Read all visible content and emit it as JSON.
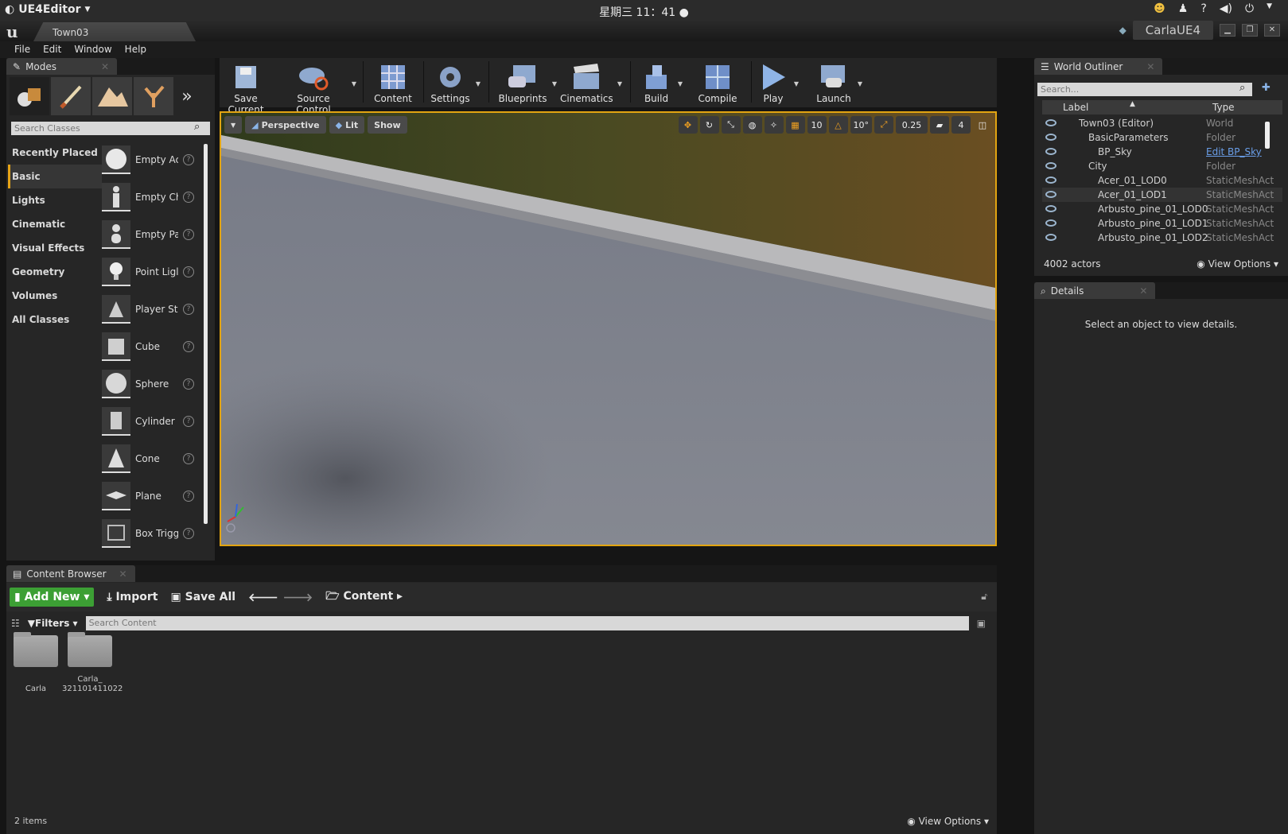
{
  "system": {
    "app_name": "UE4Editor",
    "clock": "星期三 11：41"
  },
  "window": {
    "tab": "Town03",
    "project": "CarlaUE4"
  },
  "menu": [
    "File",
    "Edit",
    "Window",
    "Help"
  ],
  "modes": {
    "title": "Modes",
    "search_placeholder": "Search Classes",
    "categories": [
      "Recently Placed",
      "Basic",
      "Lights",
      "Cinematic",
      "Visual Effects",
      "Geometry",
      "Volumes",
      "All Classes"
    ],
    "items": [
      "Empty Ac",
      "Empty Ch",
      "Empty Pa",
      "Point Ligl",
      "Player St",
      "Cube",
      "Sphere",
      "Cylinder",
      "Cone",
      "Plane",
      "Box Trigg"
    ]
  },
  "toolbar": {
    "buttons": [
      "Save Current",
      "Source Control",
      "Content",
      "Settings",
      "Blueprints",
      "Cinematics",
      "Build",
      "Compile",
      "Play",
      "Launch"
    ]
  },
  "viewport": {
    "view_mode": "Perspective",
    "lighting": "Lit",
    "show": "Show",
    "grid_snap": "10",
    "rotation_snap": "10°",
    "scale_snap": "0.25",
    "camera_speed": "4"
  },
  "outliner": {
    "title": "World Outliner",
    "search_placeholder": "Search...",
    "col_label": "Label",
    "col_type": "Type",
    "rows": [
      {
        "label": "Town03 (Editor)",
        "type": "World"
      },
      {
        "label": "BasicParameters",
        "type": "Folder"
      },
      {
        "label": "BP_Sky",
        "type": "Edit BP_Sky"
      },
      {
        "label": "City",
        "type": "Folder"
      },
      {
        "label": "Acer_01_LOD0",
        "type": "StaticMeshAct"
      },
      {
        "label": "Acer_01_LOD1",
        "type": "StaticMeshAct"
      },
      {
        "label": "Arbusto_pine_01_LOD0",
        "type": "StaticMeshAct"
      },
      {
        "label": "Arbusto_pine_01_LOD1",
        "type": "StaticMeshAct"
      },
      {
        "label": "Arbusto_pine_01_LOD2",
        "type": "StaticMeshAct"
      }
    ],
    "actor_count": "4002 actors",
    "view_options": "View Options"
  },
  "details": {
    "title": "Details",
    "message": "Select an object to view details."
  },
  "content_browser": {
    "title": "Content Browser",
    "add_new": "Add New",
    "import": "Import",
    "save_all": "Save All",
    "path": "Content",
    "filters": "Filters",
    "search_placeholder": "Search Content",
    "folders": [
      {
        "name": "Carla"
      },
      {
        "name": "Carla_\n321101411022"
      }
    ],
    "item_count": "2 items",
    "view_options": "View Options"
  }
}
